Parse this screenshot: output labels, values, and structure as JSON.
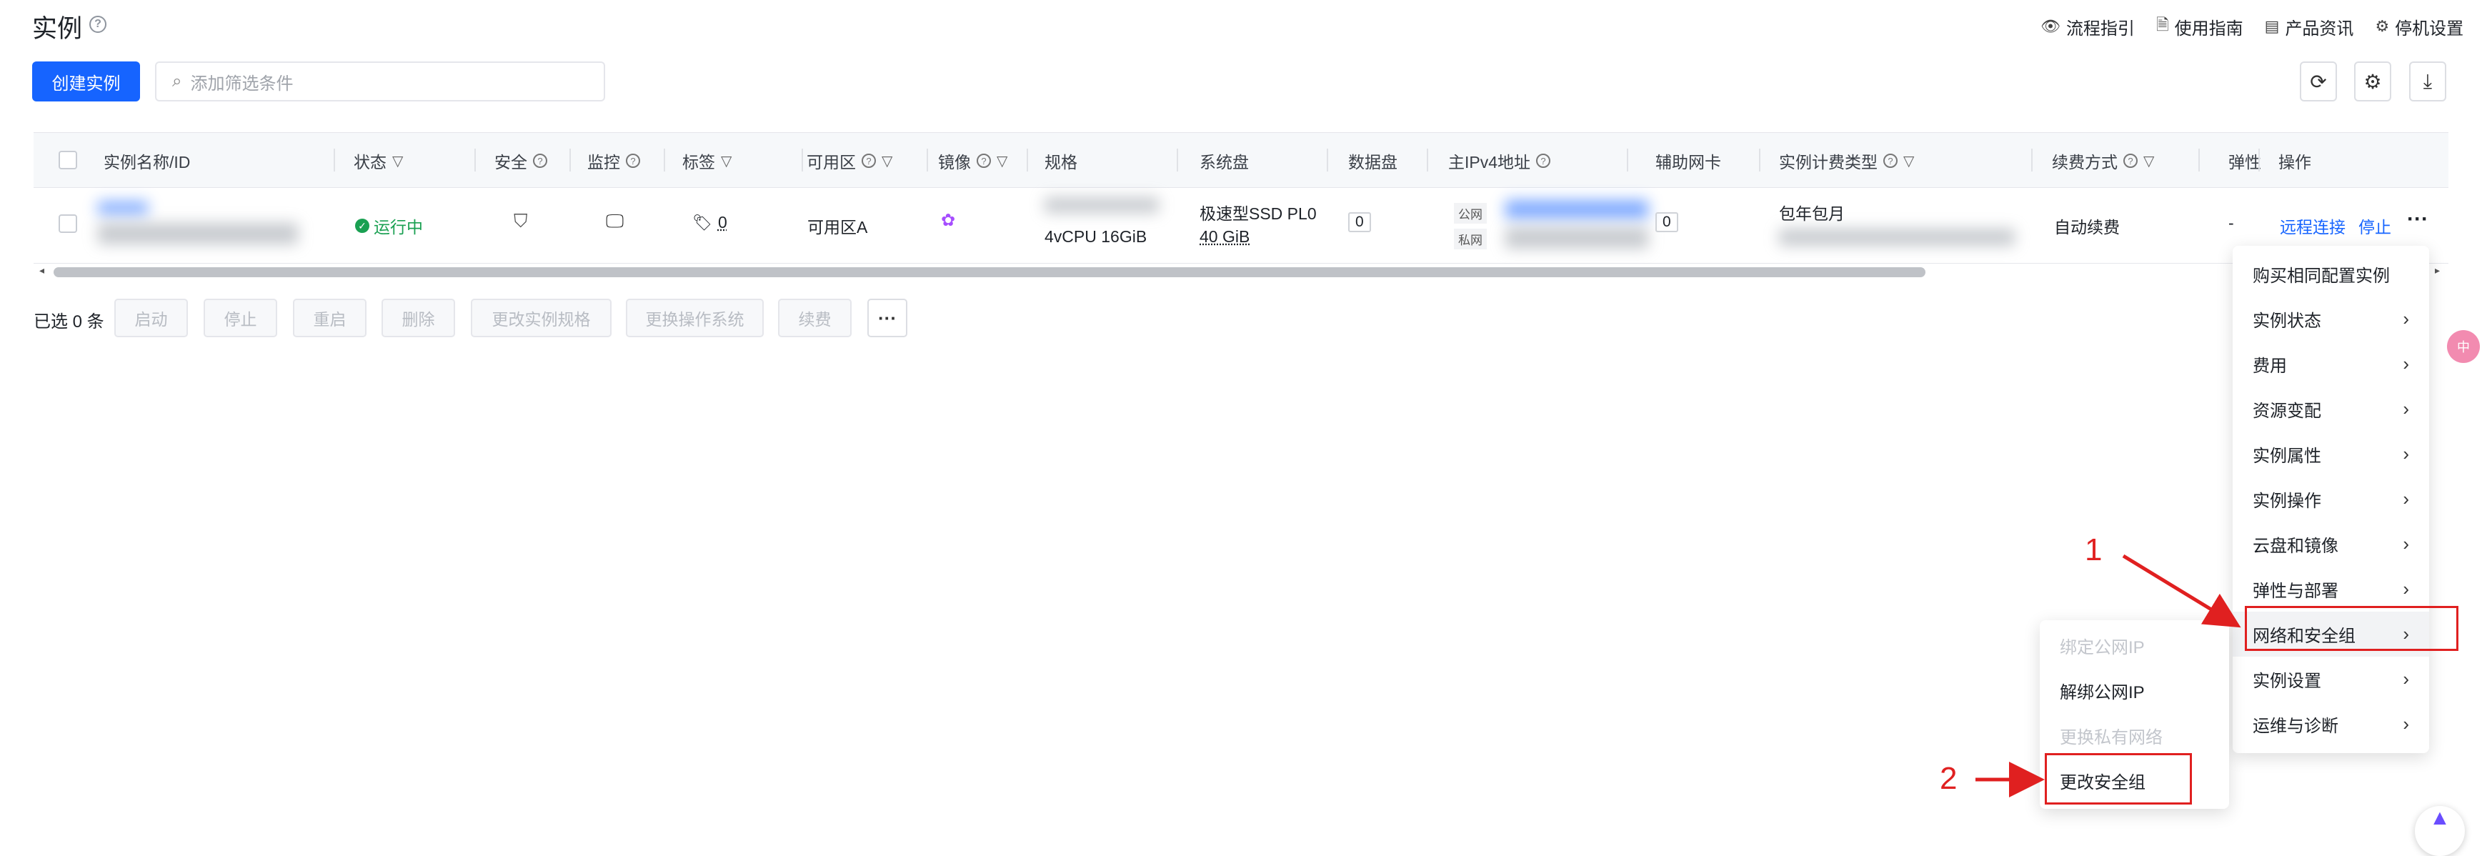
{
  "header": {
    "title": "实例",
    "links": [
      {
        "label": "流程指引",
        "icon": "eye-icon"
      },
      {
        "label": "使用指南",
        "icon": "document-icon"
      },
      {
        "label": "产品资讯",
        "icon": "news-icon"
      },
      {
        "label": "停机设置",
        "icon": "gear-icon"
      }
    ]
  },
  "toolbar": {
    "create_label": "创建实例",
    "search_placeholder": "添加筛选条件"
  },
  "table": {
    "columns": [
      "实例名称/ID",
      "状态",
      "安全",
      "监控",
      "标签",
      "可用区",
      "镜像",
      "规格",
      "系统盘",
      "数据盘",
      "主IPv4地址",
      "辅助网卡",
      "实例计费类型",
      "续费方式",
      "弹性",
      "操作"
    ],
    "row": {
      "status": "运行中",
      "tag_count": "0",
      "zone": "可用区A",
      "spec": "4vCPU   16GiB",
      "system_disk_type": "极速型SSD PL0",
      "system_disk_size": "40 GiB",
      "data_disk_count": "0",
      "ip_public_label": "公网",
      "ip_private_label": "私网",
      "secondary_nic_count": "0",
      "billing_type": "包年包月",
      "renewal": "自动续费",
      "elastic": "-",
      "action_remote": "远程连接",
      "action_stop": "停止"
    }
  },
  "batch": {
    "selected_label": "已选 0 条",
    "buttons": [
      "启动",
      "停止",
      "重启",
      "删除",
      "更改实例规格",
      "更换操作系统",
      "续费"
    ]
  },
  "main_menu": [
    "购买相同配置实例",
    "实例状态",
    "费用",
    "资源变配",
    "实例属性",
    "实例操作",
    "云盘和镜像",
    "弹性与部署",
    "网络和安全组",
    "实例设置",
    "运维与诊断"
  ],
  "sub_menu": [
    {
      "label": "绑定公网IP",
      "disabled": true
    },
    {
      "label": "解绑公网IP",
      "disabled": false
    },
    {
      "label": "更换私有网络",
      "disabled": true
    },
    {
      "label": "更改安全组",
      "disabled": false
    }
  ],
  "annotations": {
    "step1": "1",
    "step2": "2"
  },
  "colors": {
    "primary": "#1664ff",
    "success": "#1aa052",
    "annotation": "#e02020"
  }
}
